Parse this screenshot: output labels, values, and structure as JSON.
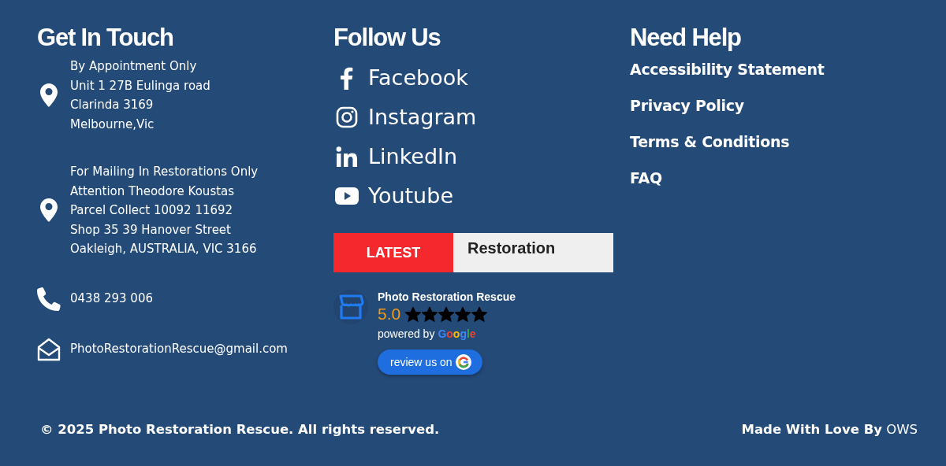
{
  "contact": {
    "title": "Get In Touch",
    "items": [
      {
        "kind": "location",
        "lines": [
          "By Appointment Only",
          "Unit 1 27B Eulinga road",
          "Clarinda 3169",
          "Melbourne,Vic"
        ]
      },
      {
        "kind": "location",
        "lines": [
          "For Mailing In Restorations Only",
          "Attention Theodore Koustas",
          "Parcel Collect 10092 11692",
          "Shop 35 39 Hanover Street",
          "Oakleigh, AUSTRALIA, VIC 3166"
        ]
      },
      {
        "kind": "phone",
        "lines": [
          "0438 293 006"
        ]
      },
      {
        "kind": "email",
        "lines": [
          "PhotoRestorationRescue@gmail.com"
        ]
      }
    ]
  },
  "follow": {
    "title": "Follow Us",
    "links": [
      {
        "kind": "facebook",
        "label": "Facebook"
      },
      {
        "kind": "instagram",
        "label": "Instagram"
      },
      {
        "kind": "linkedin",
        "label": "LinkedIn"
      },
      {
        "kind": "youtube",
        "label": "Youtube"
      }
    ],
    "ticker": {
      "badge": "LATEST",
      "text": "Restoration"
    },
    "review": {
      "name": "Photo Restoration Rescue",
      "rating": "5.0",
      "stars": 5,
      "powered_by": "powered by",
      "google": "Google",
      "button": "review us on"
    }
  },
  "help": {
    "title": "Need Help",
    "links": [
      "Accessibility Statement",
      "Privacy Policy",
      "Terms & Conditions",
      "FAQ"
    ]
  },
  "footer": {
    "copyright": "© 2025 Photo Restoration Rescue. All rights reserved.",
    "credit": "**Made With Love By** OWS"
  }
}
